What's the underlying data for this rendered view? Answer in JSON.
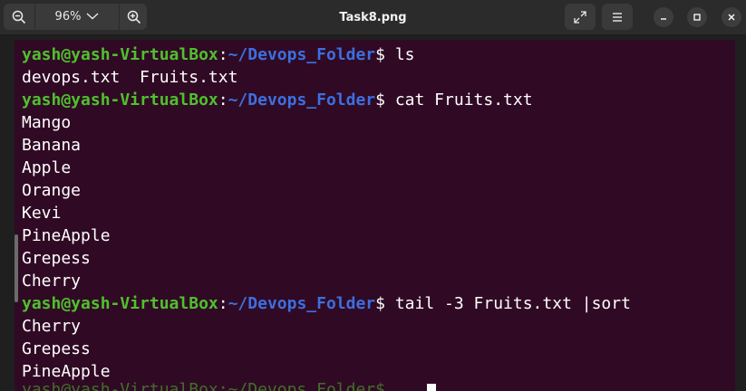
{
  "toolbar": {
    "zoom_out_icon": "zoom-out-icon",
    "zoom_level": "96%",
    "zoom_in_icon": "zoom-in-icon",
    "title": "Task8.png",
    "fullscreen_icon": "fullscreen-icon",
    "menu_icon": "hamburger-menu-icon"
  },
  "window_controls": {
    "minimize_icon": "minimize-icon",
    "maximize_icon": "maximize-icon",
    "close_icon": "close-icon"
  },
  "terminal": {
    "colors": {
      "background": "#300a24",
      "prompt_user": "#4fc12e",
      "prompt_path": "#3d6fe0",
      "text": "#ffffff"
    },
    "prompt": {
      "user_host": "yash@yash-VirtualBox",
      "colon": ":",
      "path": "~/Devops_Folder",
      "dollar": "$"
    },
    "lines": [
      {
        "type": "command",
        "cmd": " ls"
      },
      {
        "type": "output",
        "text": "devops.txt  Fruits.txt"
      },
      {
        "type": "command",
        "cmd": " cat Fruits.txt"
      },
      {
        "type": "output",
        "text": "Mango"
      },
      {
        "type": "output",
        "text": "Banana"
      },
      {
        "type": "output",
        "text": "Apple"
      },
      {
        "type": "output",
        "text": "Orange"
      },
      {
        "type": "output",
        "text": "Kevi"
      },
      {
        "type": "output",
        "text": "PineApple"
      },
      {
        "type": "output",
        "text": "Grepess"
      },
      {
        "type": "output",
        "text": "Cherry"
      },
      {
        "type": "command",
        "cmd": " tail -3 Fruits.txt |sort"
      },
      {
        "type": "output",
        "text": "Cherry"
      },
      {
        "type": "output",
        "text": "Grepess"
      },
      {
        "type": "output",
        "text": "PineApple"
      }
    ],
    "last_prompt": "yash@yash-VirtualBox:~/Devops_Folder$"
  }
}
